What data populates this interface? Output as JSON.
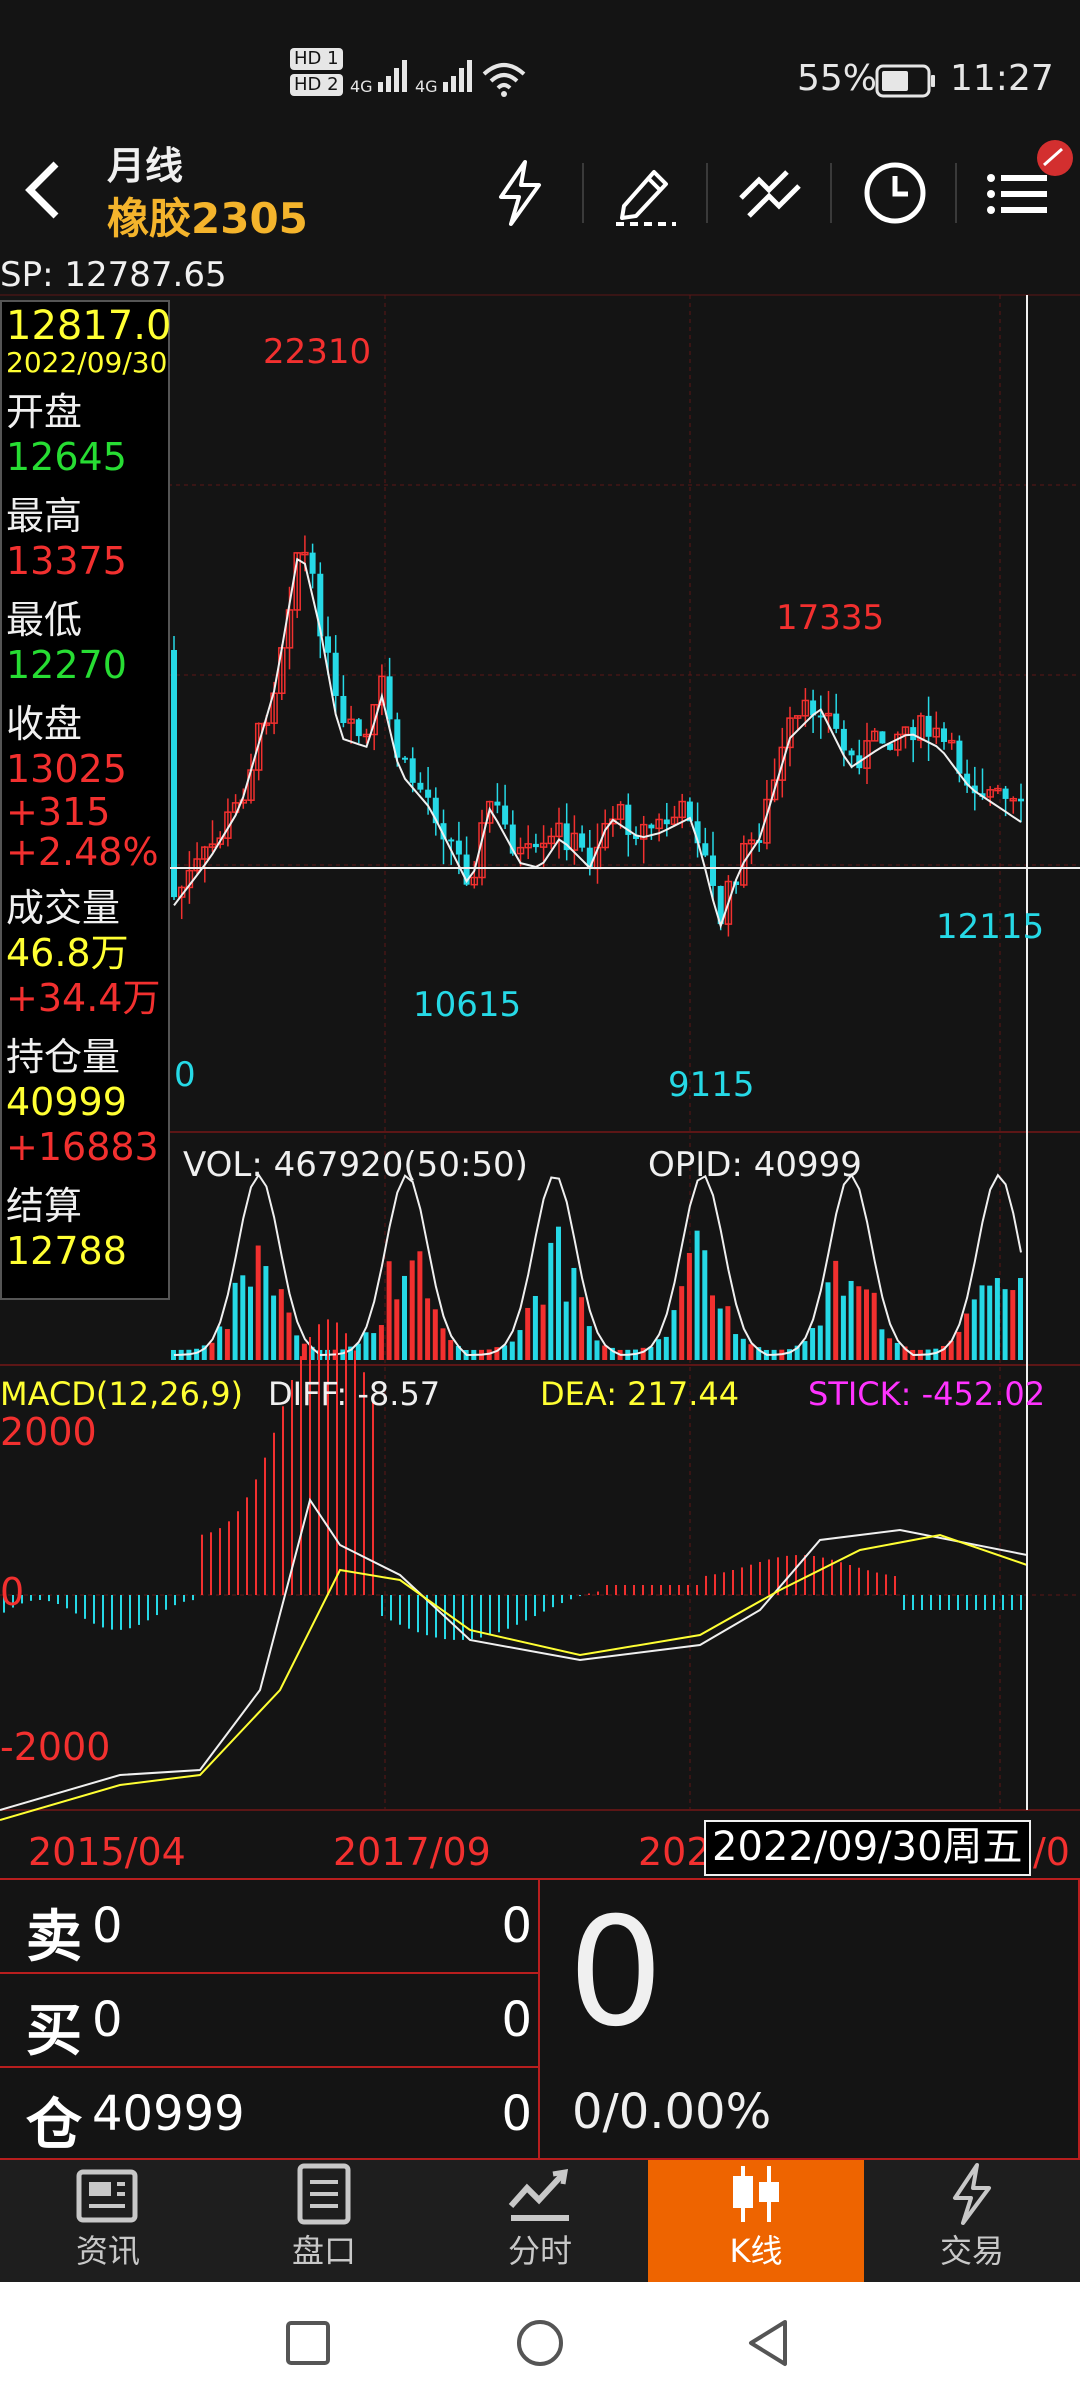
{
  "status": {
    "hd1": "HD 1",
    "hd2": "HD 2",
    "net1": "4G",
    "net2": "4G",
    "battery": "55%",
    "time": "11:27"
  },
  "header": {
    "period": "月线",
    "contract": "橡胶2305"
  },
  "chart": {
    "sp": "SP: 12787.65",
    "price_high_label": "22310",
    "price_mid_high_label": "17335",
    "price_low_label_1": "10615",
    "price_low_label_2": "9115",
    "price_low_label_3": "12115",
    "price_left_label": "0",
    "vol_label": "VOL: 467920(50:50)",
    "opid_label": "OPID: 40999",
    "macd_label": "MACD(12,26,9)",
    "diff_label": "DIFF: -8.57",
    "dea_label": "DEA: 217.44",
    "stick_label": "STICK: -452.02",
    "macd_top": "2000",
    "macd_zero": "0",
    "macd_bottom": "-2000",
    "date_1": "2015/04",
    "date_2": "2017/09",
    "date_3": "202",
    "date_4": "/0",
    "cursor_date": "2022/09/30周五",
    "colors": {
      "up": "#f2302f",
      "down": "#26d9e6",
      "dea": "#ffff33",
      "bg": "#141414"
    }
  },
  "info": {
    "price": "12817.0",
    "date": "2022/09/30",
    "open_label": "开盘",
    "open": "12645",
    "high_label": "最高",
    "high": "13375",
    "low_label": "最低",
    "low": "12270",
    "close_label": "收盘",
    "close": "13025",
    "change": "+315",
    "change_pct": "+2.48%",
    "volume_label": "成交量",
    "volume": "46.8万",
    "volume_change": "+34.4万",
    "oi_label": "持仓量",
    "oi": "40999",
    "oi_change": "+16883",
    "settle_label": "结算",
    "settle": "12788"
  },
  "order": {
    "sell_label": "卖",
    "sell_price": "0",
    "sell_qty": "0",
    "buy_label": "买",
    "buy_price": "0",
    "buy_qty": "0",
    "pos_label": "仓",
    "pos_value": "40999",
    "pos_qty": "0",
    "big_value": "0",
    "change_text": "0/0.00%"
  },
  "nav": {
    "items": [
      {
        "label": "资讯",
        "icon": "newspaper-icon"
      },
      {
        "label": "盘口",
        "icon": "order-book-icon"
      },
      {
        "label": "分时",
        "icon": "timeshare-icon"
      },
      {
        "label": "K线",
        "icon": "candlestick-icon"
      },
      {
        "label": "交易",
        "icon": "lightning-icon"
      }
    ]
  }
}
